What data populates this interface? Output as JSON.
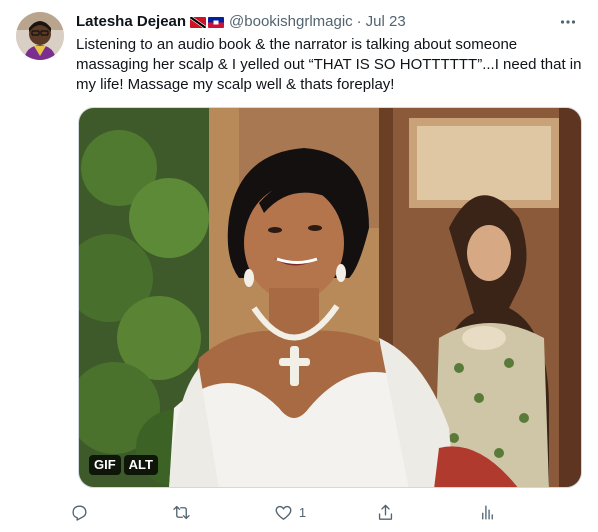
{
  "tweet": {
    "author": {
      "display_name": "Latesha Dejean",
      "handle": "@bookishgrlmagic",
      "flags": [
        "trinidad-and-tobago-flag",
        "haiti-flag"
      ]
    },
    "separator": "·",
    "timestamp": "Jul 23",
    "more_icon": "more-horizontal-icon",
    "text": "Listening to an audio book & the narrator is talking about someone massaging her scalp & I yelled out “THAT IS SO HOTTTTTT”...I need that in my life! Massage my scalp well & thats foreplay!",
    "media": {
      "type": "gif",
      "badges": {
        "gif": "GIF",
        "alt": "ALT"
      }
    },
    "actions": {
      "reply": {
        "icon": "reply-icon",
        "count": ""
      },
      "retweet": {
        "icon": "retweet-icon",
        "count": ""
      },
      "like": {
        "icon": "heart-icon",
        "count": "1"
      },
      "share": {
        "icon": "share-icon",
        "count": ""
      },
      "analytics": {
        "icon": "analytics-icon",
        "count": ""
      }
    }
  },
  "colors": {
    "text_primary": "#0f1419",
    "text_secondary": "#536471",
    "border": "#cfd9de"
  }
}
